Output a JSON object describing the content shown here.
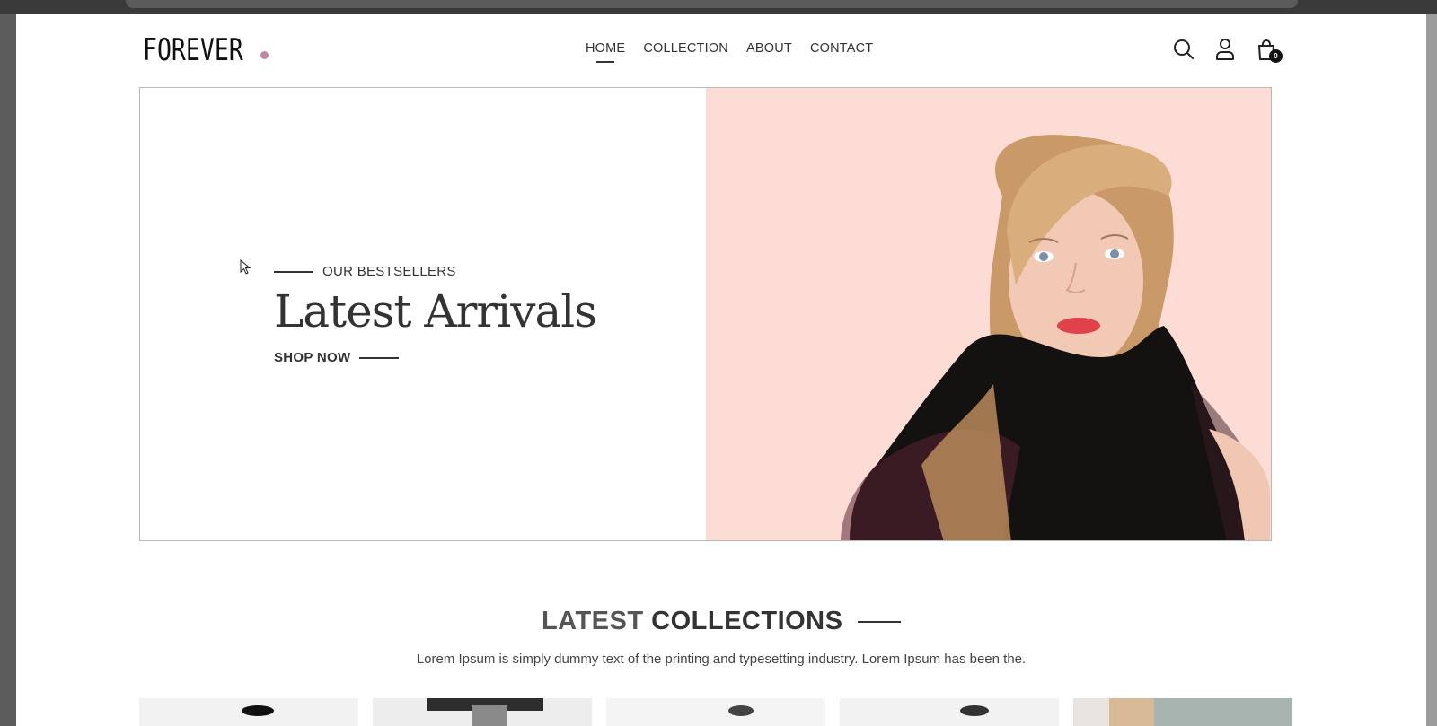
{
  "brand": {
    "logo_text": "FOREVER",
    "dot_color": "#c586a5"
  },
  "nav": {
    "items": [
      {
        "label": "HOME",
        "active": true
      },
      {
        "label": "COLLECTION",
        "active": false
      },
      {
        "label": "ABOUT",
        "active": false
      },
      {
        "label": "CONTACT",
        "active": false
      }
    ]
  },
  "header_icons": {
    "search": "search-icon",
    "profile": "profile-icon",
    "cart": "cart-icon",
    "cart_count": "0"
  },
  "hero": {
    "tagline": "OUR BESTSELLERS",
    "title": "Latest Arrivals",
    "cta": "SHOP NOW",
    "image_bg": "#fcdcd4"
  },
  "collections": {
    "title_light": "LATEST",
    "title_bold": "COLLECTIONS",
    "subtitle": "Lorem Ipsum is simply dummy text of the printing and typesetting industry. Lorem Ipsum has been the."
  }
}
